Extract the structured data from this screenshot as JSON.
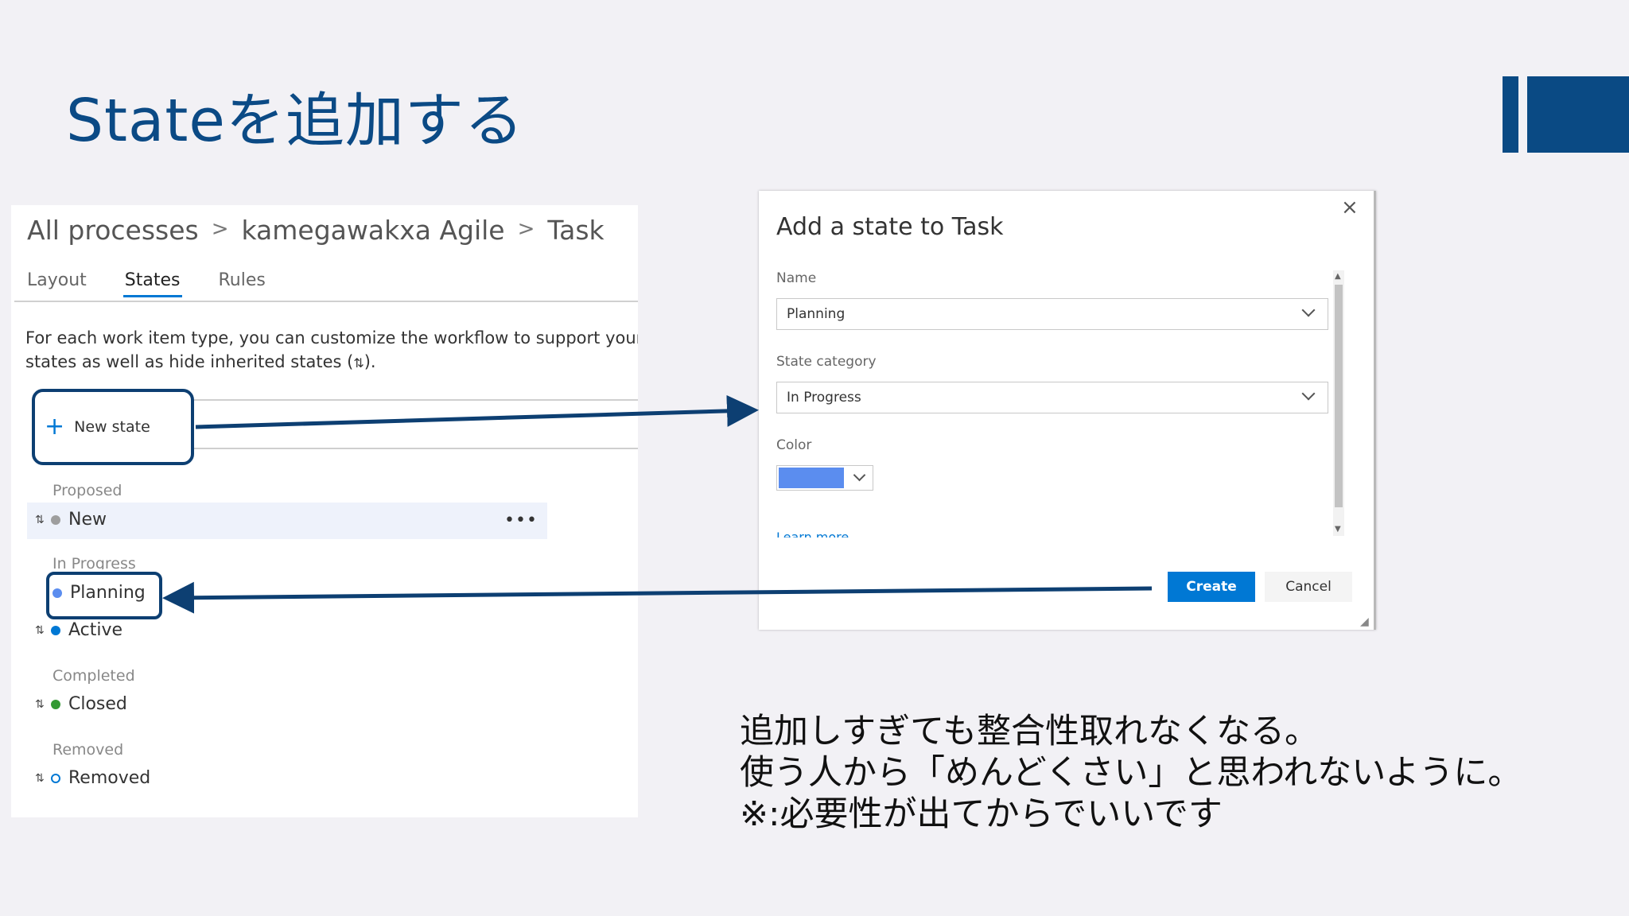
{
  "slide": {
    "title": "Stateを追加する",
    "note_lines": [
      "追加しすぎても整合性取れなくなる。",
      "使う人から「めんどくさい」と思われないように。",
      "※:必要性が出てからでいいです"
    ]
  },
  "process_page": {
    "breadcrumb": [
      "All processes",
      "kamegawakxa Agile",
      "Task"
    ],
    "tabs": [
      {
        "label": "Layout",
        "active": false
      },
      {
        "label": "States",
        "active": true
      },
      {
        "label": "Rules",
        "active": false
      }
    ],
    "description_lines": [
      "For each work item type, you can customize the workflow to support your tea",
      "states as well as hide inherited states ("
    ],
    "description_end": ").",
    "inherited_glyph": "⇅",
    "new_state_label": "New state",
    "more_glyph": "•••",
    "categories": [
      {
        "label": "Proposed",
        "states": [
          {
            "name": "New",
            "color": "#9e9e9e",
            "inherited": true
          }
        ]
      },
      {
        "label": "In Progress",
        "states": [
          {
            "name": "Planning",
            "color": "#5b8def",
            "inherited": false
          },
          {
            "name": "Active",
            "color": "#0078d4",
            "inherited": true
          }
        ]
      },
      {
        "label": "Completed",
        "states": [
          {
            "name": "Closed",
            "color": "#339933",
            "inherited": true
          }
        ]
      },
      {
        "label": "Removed",
        "states": [
          {
            "name": "Removed",
            "color": "#0078d4",
            "inherited": true,
            "hollow": true
          }
        ]
      }
    ]
  },
  "dialog": {
    "title": "Add a state to Task",
    "close_glyph": "×",
    "name_label": "Name",
    "name_value": "Planning",
    "state_category_label": "State category",
    "state_category_value": "In Progress",
    "color_label": "Color",
    "color_value": "#5b8def",
    "learn_more": "Learn more",
    "create_label": "Create",
    "cancel_label": "Cancel"
  },
  "colors": {
    "accent": "#0078d4",
    "title_blue": "#0b4a85",
    "arrow": "#0d3f72"
  }
}
